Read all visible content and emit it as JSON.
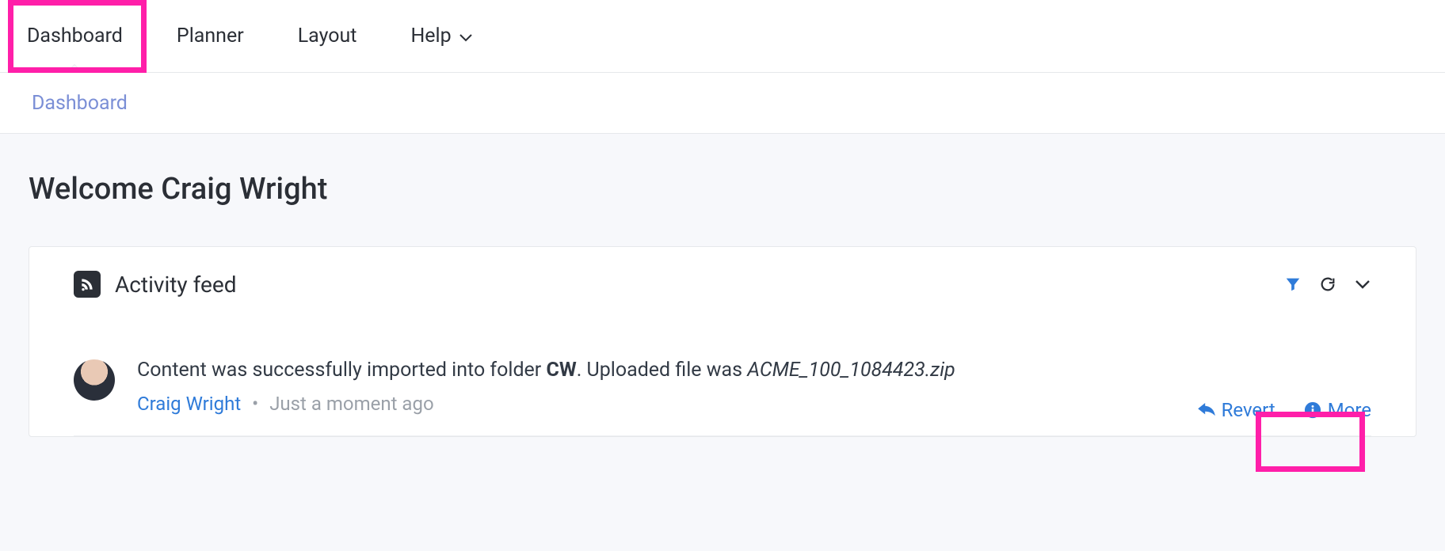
{
  "nav": {
    "tabs": [
      {
        "label": "Dashboard",
        "active": true
      },
      {
        "label": "Planner"
      },
      {
        "label": "Layout"
      },
      {
        "label": "Help",
        "dropdown": true
      }
    ]
  },
  "breadcrumb": {
    "label": "Dashboard"
  },
  "welcome": "Welcome Craig Wright",
  "activity": {
    "title": "Activity feed",
    "icons": {
      "filter": "filter-icon",
      "refresh": "refresh-icon",
      "collapse": "chevron-down-icon"
    },
    "items": [
      {
        "text_prefix": "Content was successfully imported into folder ",
        "folder": "CW",
        "text_mid": ". Uploaded file was ",
        "filename": "ACME_100_1084423.zip",
        "author": "Craig Wright",
        "time": "Just a moment ago",
        "revert_label": "Revert",
        "more_label": "More"
      }
    ]
  }
}
